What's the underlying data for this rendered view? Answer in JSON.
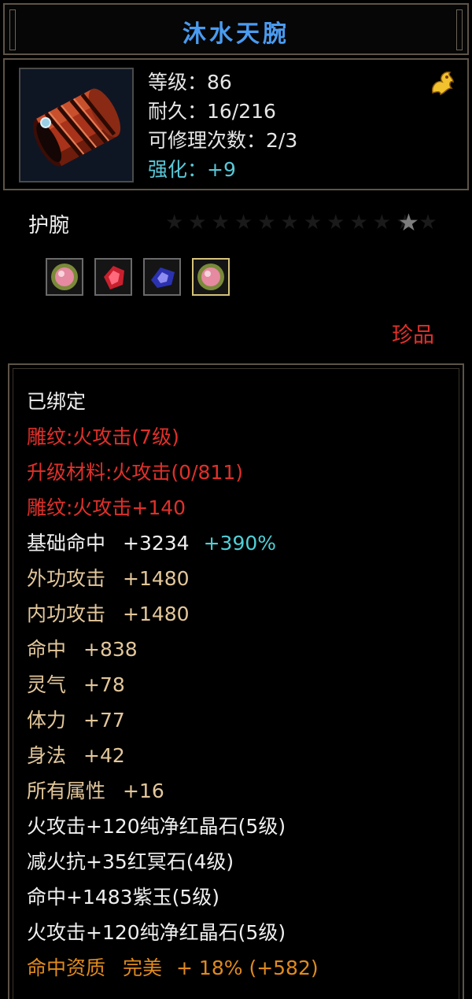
{
  "title": "沐水天腕",
  "colors": {
    "title": "#4a9bf0",
    "red": "#e0302a",
    "tan": "#e3c79a",
    "cyan": "#4fd0d8",
    "orange": "#e08a1e"
  },
  "header": {
    "level": "等级：86",
    "durability": "耐久：16/216",
    "repair": "可修理次数：2/3",
    "enhance": "强化：+9",
    "quality_icon": "gold-dragon-icon"
  },
  "item_type": "护腕",
  "gems": [
    "pink-gem-icon",
    "red-gem-icon",
    "blue-gem-icon",
    "pink-gem-icon"
  ],
  "rarity": "珍品",
  "attributes": [
    {
      "text": "已绑定"
    },
    {
      "text": "雕纹:火攻击(7级)"
    },
    {
      "text": "升级材料:火攻击(0/811)"
    },
    {
      "text": "雕纹:火攻击+140"
    },
    {
      "name": "基础命中",
      "value": "+3234",
      "bonus": "+390%"
    },
    {
      "name": "外功攻击",
      "value": "+1480"
    },
    {
      "name": "内功攻击",
      "value": "+1480"
    },
    {
      "name": "命中",
      "value": "+838"
    },
    {
      "name": "灵气",
      "value": "+78"
    },
    {
      "name": "体力",
      "value": "+77"
    },
    {
      "name": "身法",
      "value": "+42"
    },
    {
      "name": "所有属性",
      "value": "+16"
    },
    {
      "text": "火攻击+120纯净红晶石(5级)"
    },
    {
      "text": "减火抗+35红冥石(4级)"
    },
    {
      "text": "命中+1483紫玉(5级)"
    },
    {
      "text": "火攻击+120纯净红晶石(5级)"
    },
    {
      "name": "命中资质",
      "value": "完美",
      "bonus": "+ 18% (+582)"
    }
  ]
}
